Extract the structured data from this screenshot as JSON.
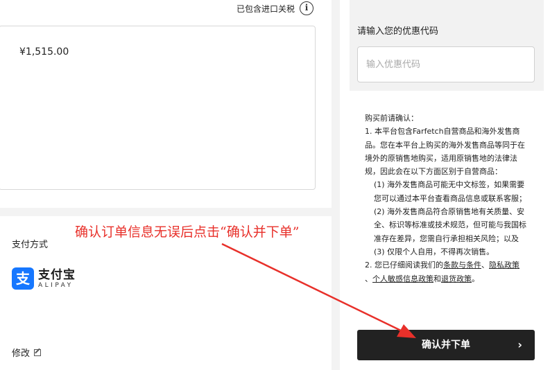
{
  "summary": {
    "tax_note": "已包含进口关税",
    "info_icon_glyph": "i",
    "price": "¥1,515.00"
  },
  "payment": {
    "title": "支付方式",
    "method_logo_glyph": "支",
    "method_name_cn": "支付宝",
    "method_name_en": "ALIPAY",
    "edit_label": "修改"
  },
  "annotation": {
    "text": "确认订单信息无误后点击“确认并下单”",
    "color": "#e8302a"
  },
  "promo": {
    "label": "请输入您的优惠代码",
    "placeholder": "输入优惠代码"
  },
  "notice": {
    "heading": "购买前请确认：",
    "item1": "1. 本平台包含Farfetch自营商品和海外发售商品。您在本平台上购买的海外发售商品等同于在境外的原销售地购买，适用原销售地的法律法规，因此会在以下方面区别于自营商品：",
    "sub1": "(1) 海外发售商品可能无中文标签，如果需要您可以通过本平台查看商品信息或联系客服；",
    "sub2": "(2) 海外发售商品符合原销售地有关质量、安全、标识等标准或技术规范，但可能与我国标准存在差异，您需自行承担相关风险；以及",
    "sub3": "(3) 仅限个人自用，不得再次销售。",
    "item2_prefix": "2. 您已仔细阅读我们的",
    "link_terms": "条款与条件",
    "sep1": "、",
    "link_privacy": "隐私政策",
    "sep2": "、",
    "link_sensitive": "个人敏感信息政策",
    "sep3": "和",
    "link_returns": "退货政策",
    "end": "。"
  },
  "confirm": {
    "label": "确认并下单",
    "chevron": "›"
  },
  "colors": {
    "button_bg": "#222222",
    "promo_bg": "#f2f2f2",
    "alipay_blue": "#1677ff",
    "annotation_red": "#e8302a"
  }
}
